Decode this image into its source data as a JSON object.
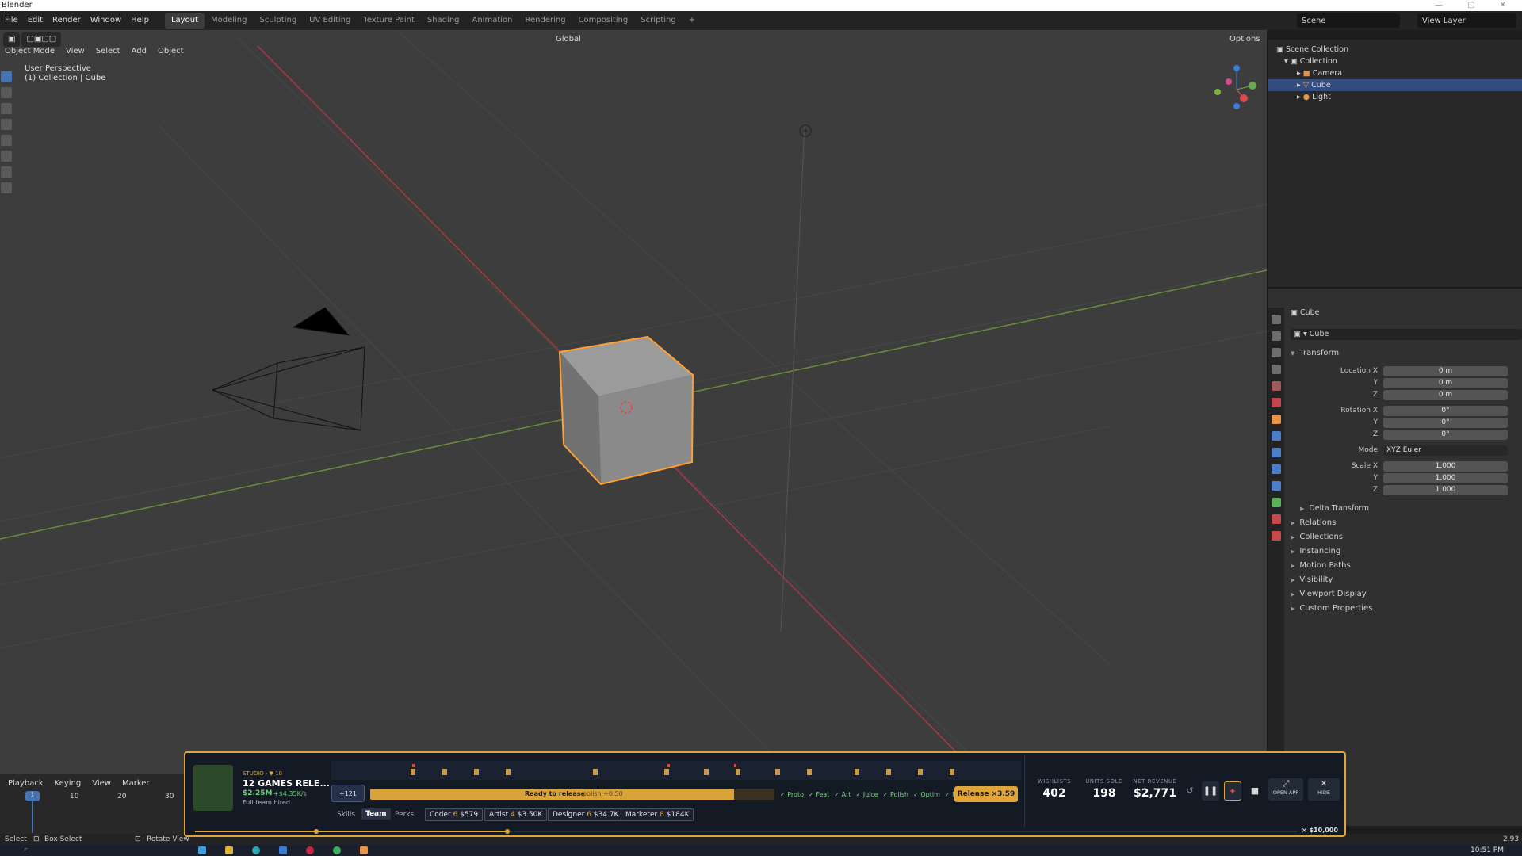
{
  "window": {
    "title": "Blender"
  },
  "menus": [
    "File",
    "Edit",
    "Render",
    "Window",
    "Help"
  ],
  "workspaces": [
    {
      "label": "Layout",
      "active": true
    },
    {
      "label": "Modeling"
    },
    {
      "label": "Sculpting"
    },
    {
      "label": "UV Editing"
    },
    {
      "label": "Texture Paint"
    },
    {
      "label": "Shading"
    },
    {
      "label": "Animation"
    },
    {
      "label": "Rendering"
    },
    {
      "label": "Compositing"
    },
    {
      "label": "Scripting"
    }
  ],
  "add_workspace": "+",
  "scene": "Scene",
  "view_layer": "View Layer",
  "viewport": {
    "mode": "Object Mode",
    "menus": [
      "View",
      "Select",
      "Add",
      "Object"
    ],
    "orientation": "Global",
    "options": "Options",
    "perspective": "User Perspective",
    "collection_path": "(1) Collection | Cube"
  },
  "outliner": {
    "root": "Scene Collection",
    "collection": "Collection",
    "items": [
      "Camera",
      "Cube",
      "Light"
    ],
    "selected": "Cube"
  },
  "properties": {
    "object_name": "Cube",
    "data_name": "Cube",
    "transform_header": "Transform",
    "location": {
      "label": "Location X",
      "x": "0 m",
      "y": "0 m",
      "z": "0 m"
    },
    "rotation": {
      "label": "Rotation X",
      "x": "0°",
      "y": "0°",
      "z": "0°"
    },
    "mode_label": "Mode",
    "mode_value": "XYZ Euler",
    "scale": {
      "label": "Scale X",
      "x": "1.000",
      "y": "1.000",
      "z": "1.000"
    },
    "axis_y": "Y",
    "axis_z": "Z",
    "delta_transform": "Delta Transform",
    "sections": [
      "Relations",
      "Collections",
      "Instancing",
      "Motion Paths",
      "Visibility",
      "Viewport Display",
      "Custom Properties"
    ]
  },
  "timeline": {
    "menus": [
      "Playback",
      "Keying",
      "View",
      "Marker"
    ],
    "current_frame": "1",
    "ticks": [
      "10",
      "20",
      "30"
    ]
  },
  "statusbar": {
    "select": "Select",
    "box_select": "Box Select",
    "rotate_view": "Rotate View",
    "version": "2.93"
  },
  "taskbar": {
    "time": "10:51 PM"
  },
  "game": {
    "studio_label": "STUDIO · ▼ 10",
    "game_title": "12 GAMES RELE...",
    "money": "$2.25M",
    "rate": "+$4.35K/s",
    "team_status": "Full team hired",
    "small_badge": "+121",
    "progress_text": "Ready to release",
    "polish_text": "polish +0.50",
    "progress": 0.9,
    "checks": [
      "✓ Proto",
      "✓ Feat",
      "✓ Art",
      "✓ Juice",
      "✓ Polish",
      "✓ Optim",
      "✓ Mktg"
    ],
    "release_button": "Release ×3.59",
    "tabs": [
      "Skills",
      "Team",
      "Perks"
    ],
    "active_tab": "Team",
    "employees": [
      {
        "role": "Coder",
        "count": "6",
        "cost": "$579"
      },
      {
        "role": "Artist",
        "count": "4",
        "cost": "$3.50K"
      },
      {
        "role": "Designer",
        "count": "6",
        "cost": "$34.7K"
      },
      {
        "role": "Marketer",
        "count": "8",
        "cost": "$184K"
      }
    ],
    "wishlists_label": "WISHLISTS",
    "wishlists": "402",
    "units_label": "UNITS SOLD",
    "units": "198",
    "revenue_label": "NET REVENUE",
    "revenue": "$2,771",
    "open_app": "OPEN APP",
    "hide": "HIDE",
    "goal": "× $10,000"
  },
  "colors": {
    "accent": "#4772b3",
    "selection": "#ffa033",
    "game_border": "#e0a53a",
    "progress": "#d9a23a"
  }
}
